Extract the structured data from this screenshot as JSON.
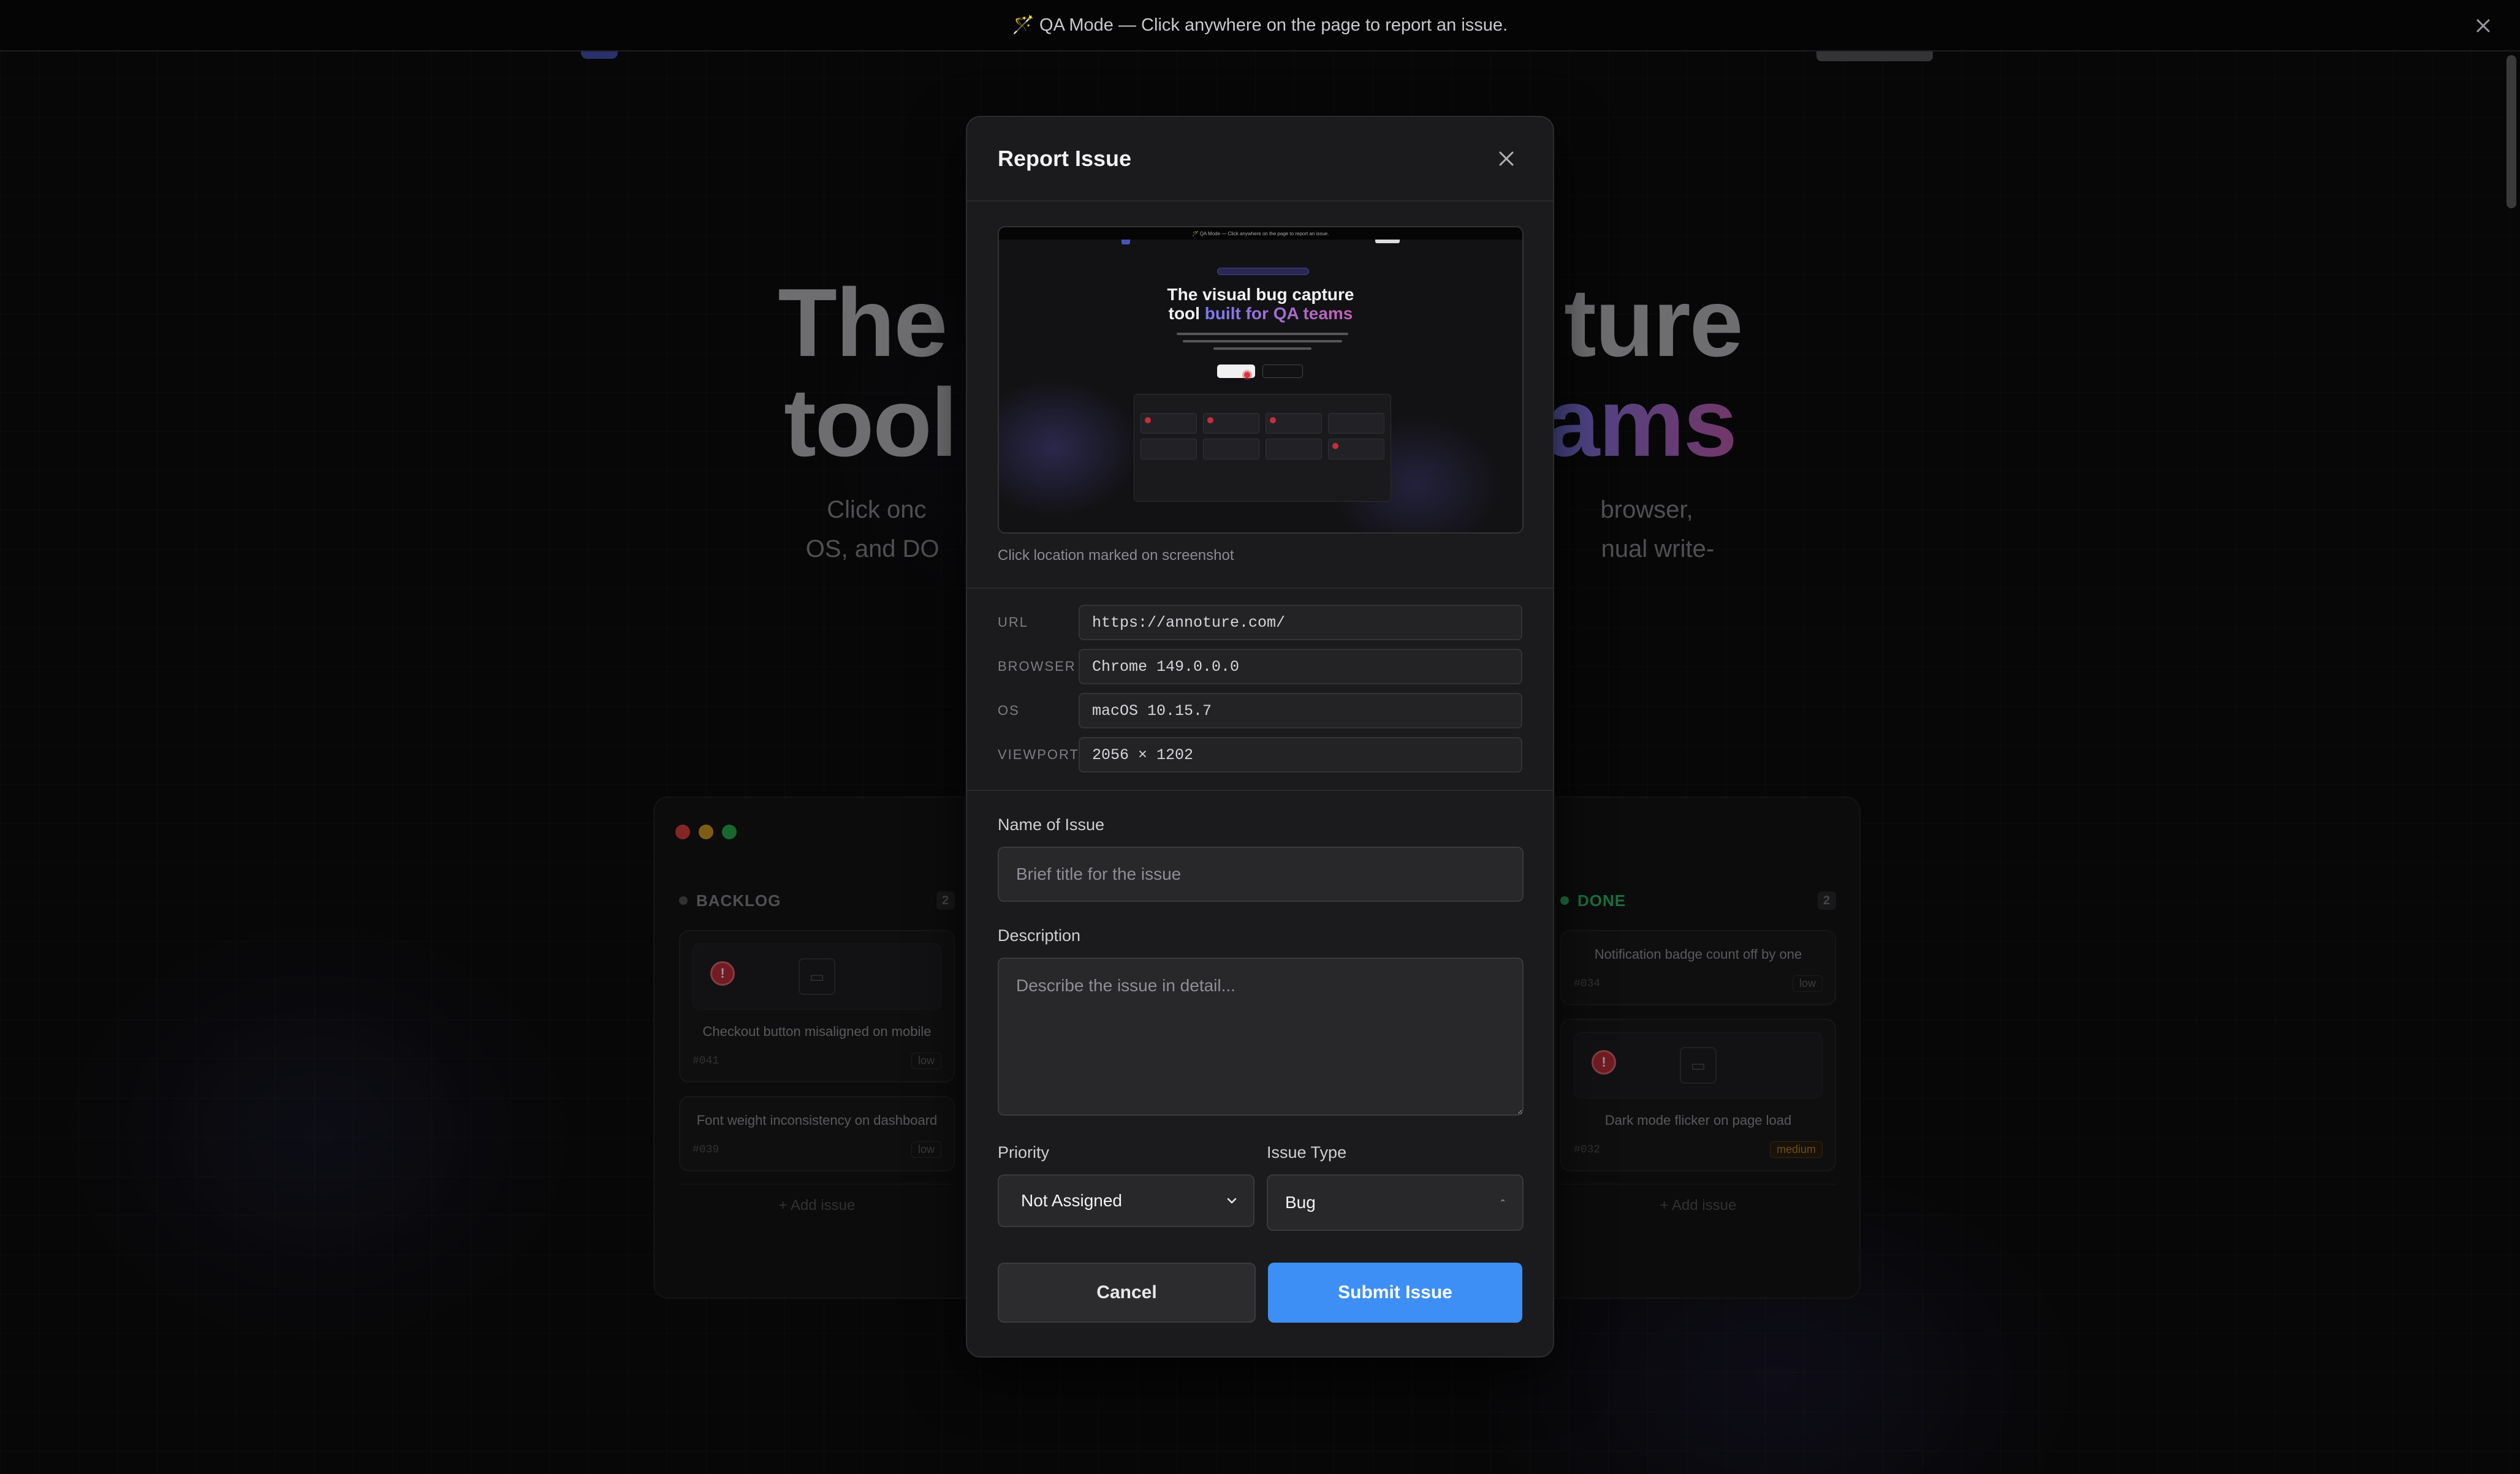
{
  "qa_banner": {
    "icon": "magic-wand-icon",
    "text": "🪄 QA Mode — Click anywhere on the page to report an issue."
  },
  "background": {
    "hero_line1_a": "The v",
    "hero_line1_b": "ture",
    "hero_line2_a": "tool ",
    "hero_line2_b": "ams",
    "sub_line1_a": "Click onc",
    "sub_line1_b": "browser,",
    "sub_line2_a": "OS, and DO",
    "sub_line2_b": "nual write-",
    "board": {
      "backlog": {
        "title": "BACKLOG",
        "count": "2",
        "cards": [
          {
            "title": "Checkout button misaligned on mobile",
            "id": "#041",
            "tag": "low"
          },
          {
            "title": "Font weight inconsistency on dashboard",
            "id": "#039",
            "tag": "low"
          }
        ],
        "add": "+ Add issue"
      },
      "done": {
        "title": "DONE",
        "count": "2",
        "cards": [
          {
            "title": "Notification badge count off by one",
            "id": "#034",
            "tag": "low"
          },
          {
            "title": "Dark mode flicker on page load",
            "id": "#032",
            "tag": "medium"
          }
        ],
        "add": "+ Add issue"
      }
    }
  },
  "modal": {
    "title": "Report Issue",
    "screenshot": {
      "banner": "🪄 QA Mode — Click anywhere on the page to report an issue.",
      "headline_1": "The visual bug capture",
      "headline_2a": "tool ",
      "headline_2b": "built for QA teams"
    },
    "screenshot_caption": "Click location marked on screenshot",
    "meta": [
      {
        "label": "URL",
        "value": "https://annoture.com/"
      },
      {
        "label": "BROWSER",
        "value": "Chrome 149.0.0.0"
      },
      {
        "label": "OS",
        "value": "macOS 10.15.7"
      },
      {
        "label": "VIEWPORT",
        "value": "2056 × 1202"
      }
    ],
    "name_label": "Name of Issue",
    "name_placeholder": "Brief title for the issue",
    "description_label": "Description",
    "description_placeholder": "Describe the issue in detail...",
    "priority_label": "Priority",
    "priority_value": "Not Assigned",
    "type_label": "Issue Type",
    "type_value": "Bug",
    "cancel_label": "Cancel",
    "submit_label": "Submit Issue"
  },
  "colors": {
    "accent": "#3d8ff5",
    "pin_red": "#c52f3b",
    "done_green": "#2fbf71",
    "traffic_red": "#e0443e",
    "traffic_yellow": "#d9a021",
    "traffic_green": "#2bb24c"
  }
}
